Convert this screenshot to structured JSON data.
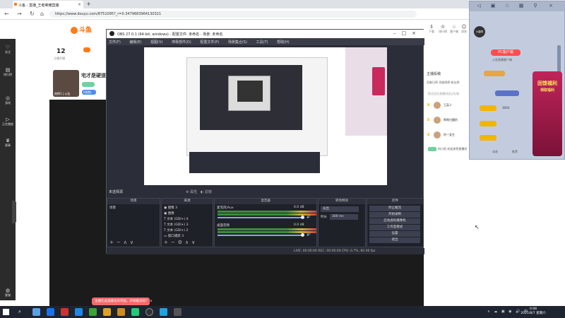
{
  "browser": {
    "tab_title": "斗鱼 - 直播_王者荣耀直播",
    "address": "https://www.douyu.com/8751095?_r=0.3479683964130321"
  },
  "site": {
    "logo_text": "斗鱼",
    "nav": [
      {
        "icon": "heart-icon",
        "glyph": "♡",
        "label": "关注"
      },
      {
        "icon": "chart-icon",
        "glyph": "▤",
        "label": "排行榜"
      },
      {
        "icon": "game-icon",
        "glyph": "◎",
        "label": "游戏"
      },
      {
        "icon": "play-icon",
        "glyph": "▷",
        "label": "正在播放"
      },
      {
        "icon": "trophy-icon",
        "glyph": "♛",
        "label": "赛事"
      },
      {
        "icon": "headset-icon",
        "glyph": "◍",
        "label": "客服"
      }
    ],
    "follows_count": "12",
    "follows_label": "主播开播",
    "room_thumb_label": "热榜1 | 公告",
    "room_title": "宅才是硬道",
    "chip_blue": "V视频",
    "top_icons": [
      {
        "icon": "download-icon",
        "glyph": "⇩",
        "label": "下载"
      },
      {
        "icon": "ranking-icon",
        "glyph": "♔",
        "label": "排行榜"
      },
      {
        "icon": "bell-icon",
        "glyph": "♧",
        "label": "客户端"
      },
      {
        "icon": "user-icon",
        "glyph": "☺",
        "label": "消息"
      }
    ],
    "rank_title": "主播投稿",
    "rank_tabs": "贡献日榜   贡献周榜   粉丝榜",
    "rank_hint": "您还没在直播间送过礼物",
    "rank_rows": [
      "王英人",
      "啊咪白酸奶",
      "阿一女生"
    ],
    "chat_line": "何小佑 欢迎来到直播间"
  },
  "overlay": {
    "avatar_text": "小唐同",
    "pc_button": "PC客户端",
    "sub_text": "斗鱼直播客户端",
    "promo_text": "回馈福利",
    "promo_sub": "领取福利",
    "rows": [
      "3004",
      "",
      ""
    ],
    "bottom_left": "动态",
    "bottom_right": "推荐"
  },
  "obs": {
    "title": "OBS 27.0.1 (64-bit, windows) - 配置文件: 未命名 - 场景: 未命名",
    "menu": [
      "文件(F)",
      "编辑(E)",
      "视图(V)",
      "停靠部件(D)",
      "配置文件(P)",
      "场景集合(S)",
      "工具(T)",
      "帮助(H)"
    ],
    "scene_label": "未选择源",
    "filter_label": "属性",
    "filter_label2": "滤镜",
    "scenes_head": "场景",
    "scene_item": "场景",
    "sources_head": "来源",
    "sources": [
      "图像 3",
      "图像",
      "文本 (GDI+) 4",
      "文本 (GDI+) 3",
      "文本 (GDI+) 2",
      "窗口捕获 3"
    ],
    "mixer_head": "混音器",
    "mixer_tracks": [
      {
        "name": "麦克风/Aux",
        "db": "0.0 dB"
      },
      {
        "name": "桌面音频",
        "db": "0.0 dB"
      }
    ],
    "transition_head": "转场特效",
    "transition_value": "淡出",
    "duration_label": "时长",
    "duration_value": "300 ms",
    "controls_head": "控件",
    "controls": [
      "停止推流",
      "开始录制",
      "启动虚拟摄像机",
      "工作室模式",
      "设置",
      "退出"
    ],
    "status": "LIVE: 00:00:00   REC: 00:00:00   CPU: 0.7%, 60.00 fps"
  },
  "toast": "主播在此直播也有奖励，开始推流吧！",
  "taskbar": {
    "time": "0:08",
    "date": "2021/8/7 星期六"
  },
  "colors": {
    "brand": "#ff7a1a",
    "obs_bg": "#2b2e38",
    "promo": "#c0245a"
  }
}
